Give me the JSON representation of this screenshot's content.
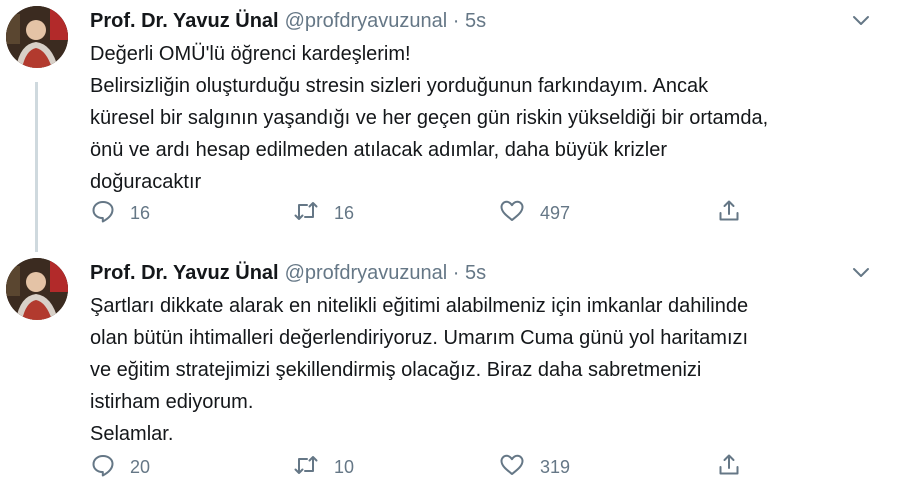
{
  "tweets": [
    {
      "name": "Prof. Dr. Yavuz Ünal",
      "handle": "@profdryavuzunal",
      "dot": "·",
      "time": "5s",
      "lines": [
        "Değerli OMÜ'lü öğrenci kardeşlerim!",
        "Belirsizliğin oluşturduğu  stresin sizleri yorduğunun farkındayım. Ancak",
        "küresel bir salgının yaşandığı ve her geçen gün riskin yükseldiği bir ortamda,",
        "önü ve ardı hesap edilmeden atılacak adımlar, daha büyük krizler",
        "doğuracaktır"
      ],
      "replies": "16",
      "retweets": "16",
      "likes": "497"
    },
    {
      "name": "Prof. Dr. Yavuz Ünal",
      "handle": "@profdryavuzunal",
      "dot": "·",
      "time": "5s",
      "lines": [
        "Şartları dikkate alarak en nitelikli eğitimi alabilmeniz  için imkanlar dahilinde",
        "olan  bütün ihtimalleri değerlendiriyoruz. Umarım Cuma günü yol haritamızı",
        "ve eğitim stratejimizi şekillendirmiş olacağız. Biraz daha sabretmenizi",
        "istirham ediyorum.",
        "Selamlar."
      ],
      "replies": "20",
      "retweets": "10",
      "likes": "319"
    }
  ],
  "icons": {
    "reply": "reply-icon",
    "retweet": "retweet-icon",
    "like": "heart-icon",
    "share": "share-icon",
    "caret": "chevron-down-icon"
  },
  "colors": {
    "text": "#14171a",
    "secondary": "#657786",
    "thread_line": "#cfd9de"
  }
}
